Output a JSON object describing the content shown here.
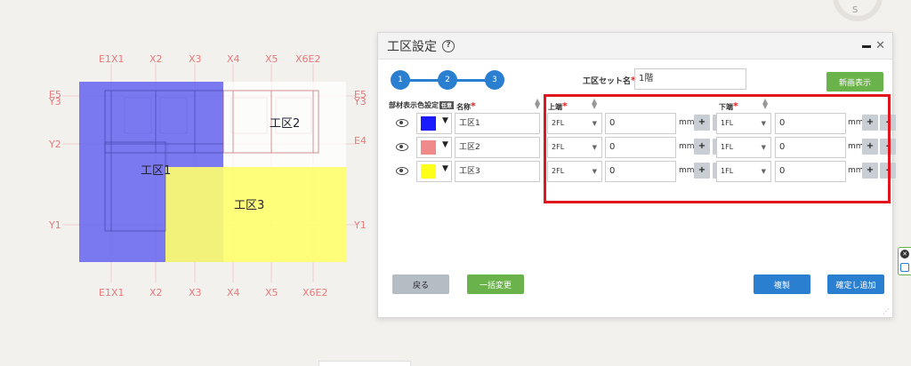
{
  "cad": {
    "zones": [
      {
        "label": "工区1",
        "color": "#6464f0"
      },
      {
        "label": "工区2",
        "color": "#ffffff"
      },
      {
        "label": "工区3",
        "color": "#ffff6e"
      }
    ],
    "axis_top": [
      "E1X1",
      "X2",
      "X3",
      "X4",
      "X5",
      "X6E2"
    ],
    "axis_bottom": [
      "E1X1",
      "X2",
      "X3",
      "X4",
      "X5",
      "X6E2"
    ],
    "axis_left": [
      "E5",
      "Y3",
      "Y2",
      "Y1"
    ],
    "axis_right": [
      "E5",
      "Y3",
      "E4",
      "Y1"
    ],
    "axis_color": "#e67a7a"
  },
  "compass": {
    "letter": "S"
  },
  "dialog": {
    "title": "工区設定",
    "steps": [
      "1",
      "2",
      "3"
    ],
    "set_name_label": "工区セット名",
    "set_name_value": "1階",
    "new_display_label": "新画表示",
    "headers": {
      "display": "部材表示",
      "color": "色設定",
      "any": "任意",
      "name": "名称",
      "top": "上端",
      "bottom": "下端"
    },
    "rows": [
      {
        "color": "#1a1aff",
        "name": "工区1",
        "top_floor": "2FL",
        "top_offset": "0",
        "bottom_floor": "1FL",
        "bottom_offset": "0"
      },
      {
        "color": "#f08a8a",
        "name": "工区2",
        "top_floor": "2FL",
        "top_offset": "0",
        "bottom_floor": "1FL",
        "bottom_offset": "0"
      },
      {
        "color": "#ffff1a",
        "name": "工区3",
        "top_floor": "2FL",
        "top_offset": "0",
        "bottom_floor": "1FL",
        "bottom_offset": "0"
      }
    ],
    "unit": "mm",
    "plus": "+",
    "minus": "-",
    "buttons": {
      "back": "戻る",
      "bulk_change": "一括変更",
      "copy": "複製",
      "confirm_add": "確定し追加"
    },
    "accent": "#2a7fd0",
    "highlight": "#e0161c"
  }
}
